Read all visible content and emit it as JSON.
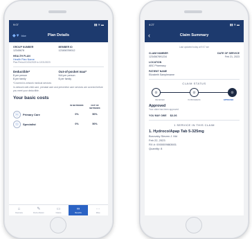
{
  "plan_details": {
    "status_time": "9:07",
    "status_icons": "▮▮ ≋ ▬",
    "logo": "◆▼",
    "logo_sub": "blue",
    "title": "Plan Details",
    "group_number_label": "GROUP NUMBER",
    "group_number": "12345678",
    "member_id_label": "MEMBER ID",
    "member_id": "123456789012",
    "health_plan_label": "HEALTH PLAN",
    "health_plan_name": "Health Plan Name",
    "plan_period": "Plan Period 01/01/2023 to 12/31/2023",
    "deductible_label": "Deductible*",
    "deductible_person": "$ per person",
    "deductible_family": "$ per family",
    "oop_label": "Out-of-pocket max*",
    "oop_person": "N/A per person",
    "oop_family": "$ per family",
    "covered_note": "*Covered in-network medical services",
    "preventive_note": "In-network well-child care, prenatal care and preventive care services are covered before you meet your deductible.",
    "basic_costs_title": "Your basic costs",
    "col_in_network": "IN NETWORK",
    "col_out_network": "OUT OF NETWORK",
    "costs": [
      {
        "name": "Primary Care",
        "in_network": "0%",
        "out_network": "50%"
      },
      {
        "name": "Specialist",
        "in_network": "0%",
        "out_network": "50%"
      }
    ],
    "tabs": [
      {
        "icon": "⌂",
        "label": "Overview"
      },
      {
        "icon": "✎",
        "label": "Find a Doctor"
      },
      {
        "icon": "▭",
        "label": "Claims"
      },
      {
        "icon": "∞",
        "label": "Benefits"
      },
      {
        "icon": "···",
        "label": "More"
      }
    ]
  },
  "claim_summary": {
    "status_time": "4:27",
    "status_icons": "▮▮ ≋ ▬",
    "title": "Claim Summary",
    "subtitle": "Last updated today at 9:07 am",
    "claim_number_label": "CLAIM NUMBER",
    "claim_number": "1234567891234",
    "date_of_service_label": "DATE OF SERVICE",
    "date_of_service": "Feb 21, 2023",
    "location_label": "LOCATION",
    "location": "ABC Pharmacy",
    "patient_name_label": "PATIENT NAME",
    "patient_name": "Elizabeth Samplename",
    "claim_status_title": "CLAIM STATUS",
    "steps": [
      "RECEIVED",
      "IN PROGRESS",
      "APPROVED"
    ],
    "approved_title": "Approved",
    "approved_note": "Your claim has been approved",
    "you_may_owe_label": "YOU MAY OWE",
    "you_may_owe": "$2.26",
    "service_count": "1 SERVICE IN THIS CLAIM",
    "service_name": "1. Hydroco/Apap Tab 5-325mg",
    "provider": "Borovsky Steven J. Md",
    "service_date": "Feb 22, 2023",
    "rx_number": "RX #: 0000009863601",
    "quantity": "Quantity: 8"
  },
  "colors": {
    "navy": "#1d3a6e",
    "accent": "#2b63c4"
  }
}
